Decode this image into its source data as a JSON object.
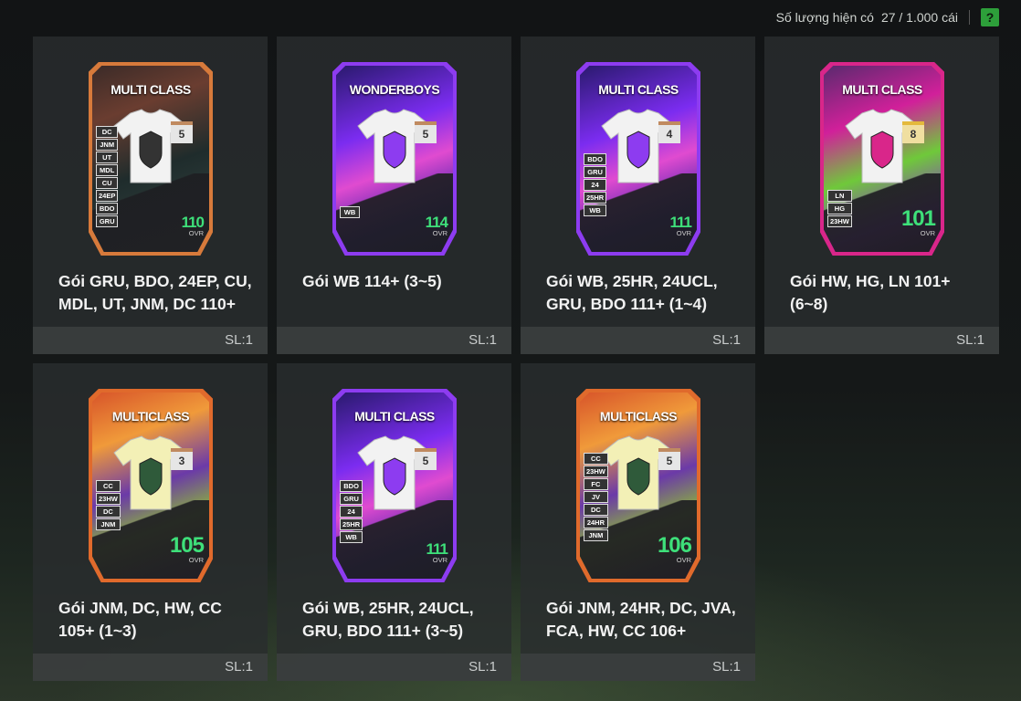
{
  "header": {
    "label": "Số lượng hiện có",
    "count": "27 / 1.000 cái",
    "help": "?"
  },
  "packs": [
    {
      "name": "Gói GRU, BDO, 24EP, CU, MDL, UT, JNM, DC 110+",
      "qty": "SL:1",
      "card": {
        "title": "MULTI CLASS",
        "grade": "5",
        "ovr": "110",
        "ovr_label": "OVR",
        "badges": [
          "DC",
          "JNM",
          "UT",
          "MDL",
          "CU",
          "24EP",
          "BDO",
          "GRU"
        ],
        "theme": "dark",
        "accent": "#d77a3b"
      }
    },
    {
      "name": "Gói WB 114+ (3~5)",
      "qty": "SL:1",
      "card": {
        "title": "WONDERBOYS",
        "grade": "5",
        "ovr": "114",
        "ovr_label": "OVR",
        "badges": [
          "WB"
        ],
        "theme": "purple",
        "accent": "#8d3cf0"
      }
    },
    {
      "name": "Gói WB, 25HR, 24UCL, GRU, BDO 111+ (1~4)",
      "qty": "SL:1",
      "card": {
        "title": "MULTI CLASS",
        "grade": "4",
        "ovr": "111",
        "ovr_label": "OVR",
        "badges": [
          "BDO",
          "GRU",
          "24",
          "25HR",
          "WB"
        ],
        "theme": "purple",
        "accent": "#8d3cf0"
      }
    },
    {
      "name": "Gói HW, HG, LN 101+ (6~8)",
      "qty": "SL:1",
      "card": {
        "title": "MULTI CLASS",
        "grade": "8",
        "ovr": "101",
        "ovr_label": "OVR",
        "badges": [
          "LN",
          "HG",
          "23HW"
        ],
        "theme": "pink",
        "accent": "#d9268a"
      }
    },
    {
      "name": "Gói JNM, DC, HW, CC 105+ (1~3)",
      "qty": "SL:1",
      "card": {
        "title": "MULTICLASS",
        "grade": "3",
        "ovr": "105",
        "ovr_label": "OVR",
        "badges": [
          "CC",
          "23HW",
          "DC",
          "JNM"
        ],
        "theme": "orange",
        "accent": "#e06a2c"
      }
    },
    {
      "name": "Gói WB, 25HR, 24UCL, GRU, BDO 111+ (3~5)",
      "qty": "SL:1",
      "card": {
        "title": "MULTI CLASS",
        "grade": "5",
        "ovr": "111",
        "ovr_label": "OVR",
        "badges": [
          "BDO",
          "GRU",
          "24",
          "25HR",
          "WB"
        ],
        "theme": "purple",
        "accent": "#8d3cf0"
      }
    },
    {
      "name": "Gói JNM, 24HR, DC, JVA, FCA, HW, CC 106+",
      "qty": "SL:1",
      "card": {
        "title": "MULTICLASS",
        "grade": "5",
        "ovr": "106",
        "ovr_label": "OVR",
        "badges": [
          "CC",
          "23HW",
          "FC",
          "JV",
          "DC",
          "24HR",
          "JNM"
        ],
        "theme": "orange",
        "accent": "#e06a2c"
      }
    }
  ]
}
